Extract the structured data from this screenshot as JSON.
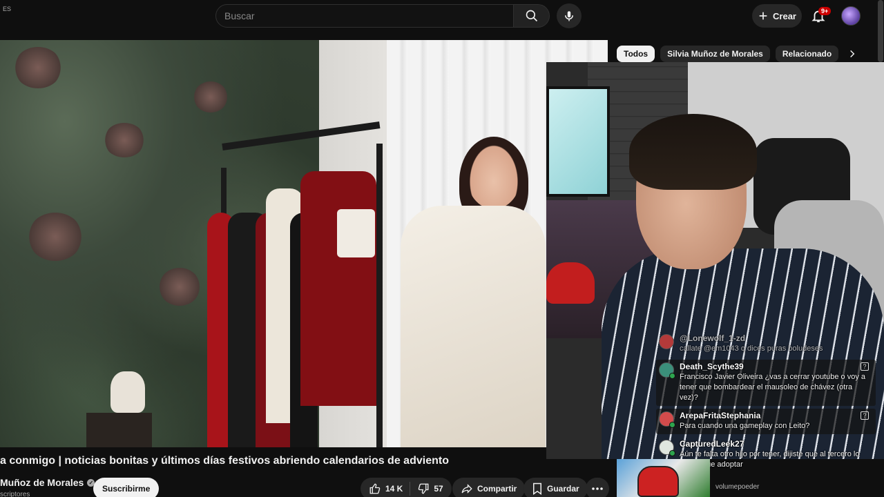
{
  "topbar": {
    "region": "ES",
    "search_placeholder": "Buscar",
    "create_label": "Crear",
    "notifications_badge": "9+"
  },
  "chips": [
    {
      "label": "Todos",
      "active": true
    },
    {
      "label": "Silvia Muñoz de Morales",
      "active": false
    },
    {
      "label": "Relacionado",
      "active": false
    }
  ],
  "video": {
    "title": "a conmigo | noticias bonitas y últimos días festivos abriendo calendarios de adviento",
    "channel": "Muñoz de Morales",
    "subscribers": "scriptores",
    "subscribe_label": "Suscribirme",
    "likes": "14 K",
    "dislikes": "57",
    "share_label": "Compartir",
    "save_label": "Guardar"
  },
  "chat": [
    {
      "user": "@Lonewolf_1-zd",
      "text": "callate @em1043 q dices puras boludeses",
      "faded": true,
      "avatar_color": "#b33a3a"
    },
    {
      "user": "Death_Scythe39",
      "text": "Francisco Javier Oliveira ¿vas a cerrar youtube o voy a tener que bombardear el mausoleo de chávez (otra vez)?",
      "faded": false,
      "avatar_color": "#3b8f7a"
    },
    {
      "user": "ArepaFritaStephania",
      "text": "Para cuando una gameplay con Leito?",
      "faded": false,
      "avatar_color": "#d24b4b"
    },
    {
      "user": "CapturedLeek27",
      "text": "Aún te falta otro hijo por tener, dijiste que al tercero lo tenías que adoptar",
      "faded": false,
      "avatar_color": "#dfe6df"
    }
  ],
  "mini_preview": {
    "label": "volumepoeder"
  },
  "colors": {
    "background": "#0f0f0f",
    "chip_active": "#f1f1f1",
    "badge": "#cc0000",
    "verified_badge": "#2da44e"
  }
}
